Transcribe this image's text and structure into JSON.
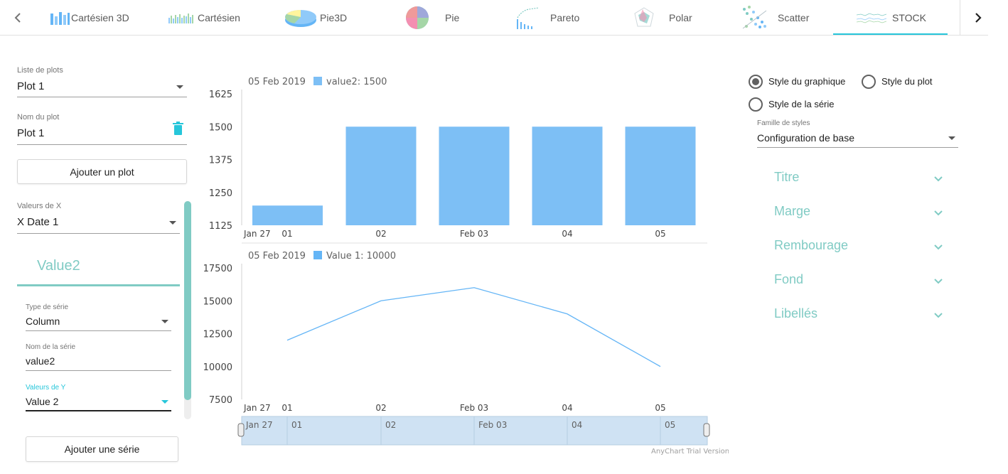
{
  "tabs": [
    {
      "label": "Cartésien 3D",
      "icon": "bar-chart-3d-icon"
    },
    {
      "label": "Cartésien",
      "icon": "bar-chart-icon"
    },
    {
      "label": "Pie3D",
      "icon": "pie-3d-icon"
    },
    {
      "label": "Pie",
      "icon": "pie-chart-icon"
    },
    {
      "label": "Pareto",
      "icon": "pareto-chart-icon"
    },
    {
      "label": "Polar",
      "icon": "polar-chart-icon"
    },
    {
      "label": "Scatter",
      "icon": "scatter-chart-icon"
    },
    {
      "label": "STOCK",
      "icon": "stock-chart-icon"
    }
  ],
  "active_tab": "STOCK",
  "left": {
    "plot_list_label": "Liste de plots",
    "plot_list_value": "Plot 1",
    "plot_name_label": "Nom du plot",
    "plot_name_value": "Plot 1",
    "add_plot": "Ajouter un plot",
    "x_values_label": "Valeurs de X",
    "x_values_value": "X Date 1",
    "series_title": "Value2",
    "series_type_label": "Type de série",
    "series_type_value": "Column",
    "series_name_label": "Nom de la série",
    "series_name_value": "value2",
    "y_values_label": "Valeurs de Y",
    "y_values_value": "Value 2",
    "add_series": "Ajouter une série"
  },
  "right": {
    "radio_chart_style": "Style du graphique",
    "radio_plot_style": "Style du plot",
    "radio_series_style": "Style de la série",
    "selected_radio": "Style du graphique",
    "style_family_label": "Famille de styles",
    "style_family_value": "Configuration de base",
    "accordion": [
      "Titre",
      "Marge",
      "Rembourage",
      "Fond",
      "Libellés"
    ]
  },
  "colors": {
    "accent": "#26c6da",
    "teal": "#80cbc4",
    "series": "#7dbff5",
    "line": "#64b5f6"
  },
  "chart_data": [
    {
      "type": "bar",
      "legend_date": "05 Feb 2019",
      "legend_text": "value2: 1500",
      "categories": [
        "01",
        "02",
        "Feb 03",
        "04",
        "05"
      ],
      "values": [
        1200,
        1500,
        1500,
        1500,
        1500
      ],
      "ylim": [
        1125,
        1625
      ],
      "yticks": [
        "1625",
        "1500",
        "1375",
        "1250",
        "1125"
      ],
      "first_label": "Jan 27"
    },
    {
      "type": "line",
      "legend_date": "05 Feb 2019",
      "legend_text": "Value 1: 10000",
      "categories": [
        "01",
        "02",
        "Feb 03",
        "04",
        "05"
      ],
      "values": [
        12000,
        15000,
        16000,
        14000,
        10000
      ],
      "ylim": [
        7500,
        17500
      ],
      "yticks": [
        "17500",
        "15000",
        "12500",
        "10000",
        "7500"
      ],
      "first_label": "Jan 27"
    }
  ],
  "scroller": {
    "labels": [
      "Jan 27",
      "01",
      "02",
      "Feb 03",
      "04",
      "05"
    ]
  },
  "credits": "AnyChart Trial Version"
}
